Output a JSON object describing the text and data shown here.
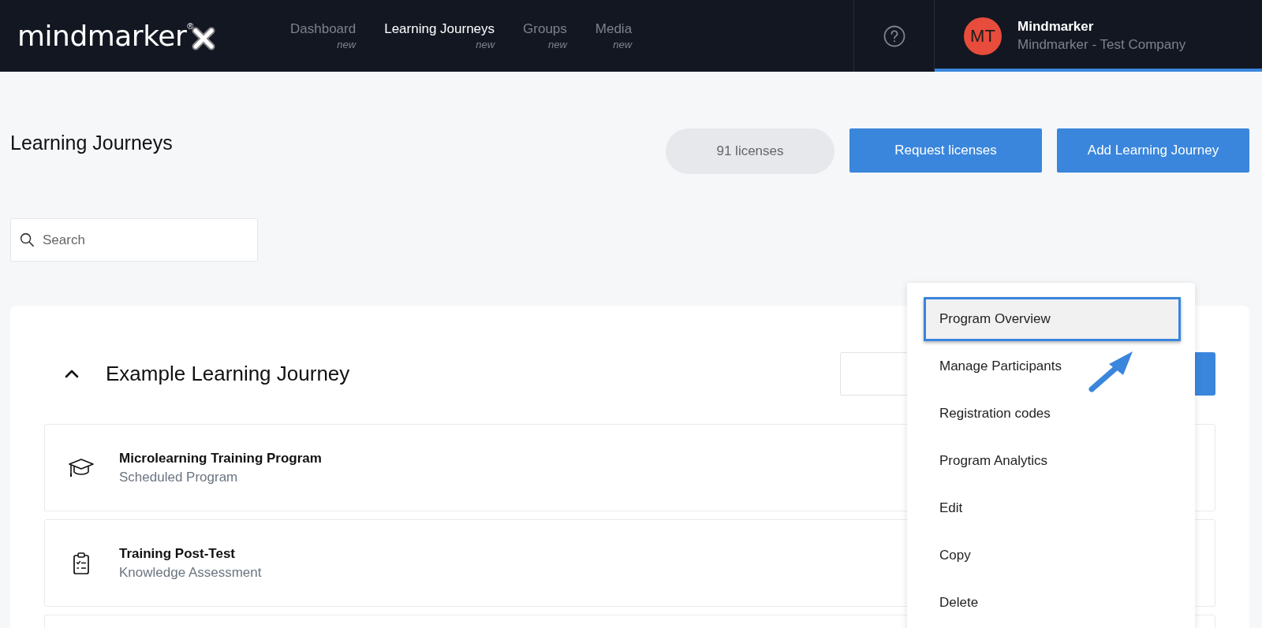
{
  "header": {
    "logo": {
      "text": "mindmarker",
      "mark": "®"
    },
    "nav": [
      {
        "label": "Dashboard",
        "badge": "new",
        "selected": false
      },
      {
        "label": "Learning Journeys",
        "badge": "new",
        "selected": true
      },
      {
        "label": "Groups",
        "badge": "new",
        "selected": false
      },
      {
        "label": "Media",
        "badge": "new",
        "selected": false
      }
    ],
    "user": {
      "initials": "MT",
      "name": "Mindmarker",
      "company": "Mindmarker - Test Company",
      "selected": true
    }
  },
  "page": {
    "title": "Learning Journeys",
    "licenses": "91 licenses",
    "buttons": [
      "Request licenses",
      "Add Learning Journey"
    ],
    "search": {
      "placeholder": "Search"
    }
  },
  "journey": {
    "title": "Example Learning Journey",
    "expanded": true,
    "rows": [
      {
        "kind": "program",
        "title": "Microlearning Training Program",
        "subtitle": "Scheduled Program"
      },
      {
        "kind": "assessment",
        "title": "Training Post-Test",
        "subtitle": "Knowledge Assessment"
      },
      {
        "kind": "blank"
      }
    ]
  },
  "menu": {
    "items": [
      {
        "label": "Program Overview",
        "selected": true
      },
      {
        "label": "Manage Participants",
        "selected": false
      },
      {
        "label": "Registration codes",
        "selected": false
      },
      {
        "label": "Program Analytics",
        "selected": false
      },
      {
        "label": "Edit",
        "selected": false
      },
      {
        "label": "Copy",
        "selected": false
      },
      {
        "label": "Delete",
        "selected": false
      }
    ]
  }
}
